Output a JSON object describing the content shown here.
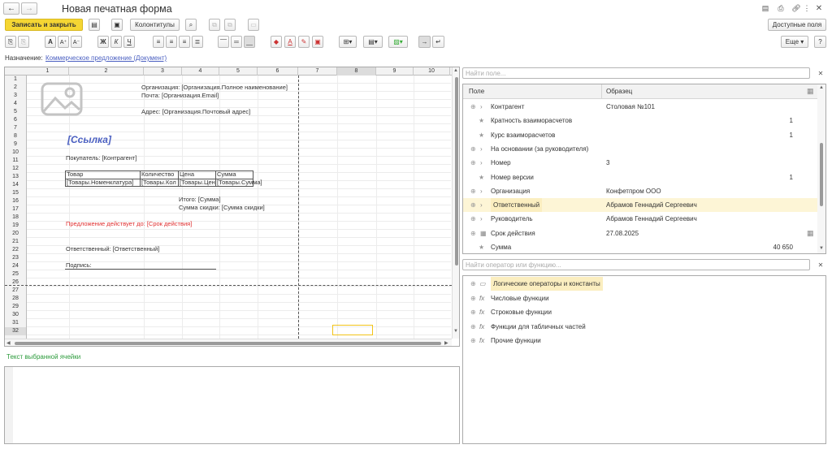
{
  "window": {
    "title": "Новая печатная форма"
  },
  "toolbar": {
    "save_close": "Записать и закрыть",
    "headers_footers": "Колонтитулы",
    "available_fields": "Доступные поля",
    "more": "Еще",
    "help": "?"
  },
  "purpose": {
    "label": "Назначение:",
    "value": "Коммерческое предложение (Документ)"
  },
  "sheet": {
    "col_headers": [
      "1",
      "2",
      "3",
      "4",
      "5",
      "6",
      "7",
      "8",
      "9",
      "10"
    ],
    "row_numbers": [
      "1",
      "2",
      "3",
      "4",
      "5",
      "6",
      "7",
      "8",
      "9",
      "10",
      "11",
      "12",
      "13",
      "14",
      "15",
      "16",
      "17",
      "18",
      "19",
      "20",
      "21",
      "22",
      "23",
      "24",
      "25",
      "26",
      "27",
      "28",
      "29",
      "30",
      "31",
      "32"
    ],
    "org_name": "Организация: [Организация.Полное наименование]",
    "mail": "Почта: [Организация.Email]",
    "address": "Адрес: [Организация.Почтовый адрес]",
    "link": "[Ссылка]",
    "buyer": "Покупатель: [Контрагент]",
    "h_goods": "Товар",
    "h_qty": "Количество",
    "h_price": "Цена",
    "h_sum": "Сумма",
    "v_goods": "[Товары.Номенклатура]",
    "v_qty": "[Товары.Кол",
    "v_price": "[Товары.Цен",
    "v_sum": "[Товары.Сумма]",
    "total": "Итого: [Сумма]",
    "discount": "Сумма скидки: [Сумма скидки]",
    "validity": "Предложение действует до: [Срок действия]",
    "responsible": "Ответственный: [Ответственный]",
    "signature": "Подпись:"
  },
  "cell_text_label": "Текст выбранной ячейки",
  "fields": {
    "search_placeholder": "Найти поле...",
    "col_field": "Поле",
    "col_sample": "Образец",
    "rows": [
      {
        "name": "Контрагент",
        "sample": "Столовая №101",
        "num": ""
      },
      {
        "name": "Кратность взаиморасчетов",
        "sample": "",
        "num": "1"
      },
      {
        "name": "Курс взаиморасчетов",
        "sample": "",
        "num": "1"
      },
      {
        "name": "На основании (за руководителя)",
        "sample": "",
        "num": ""
      },
      {
        "name": "Номер",
        "sample": "3",
        "num": ""
      },
      {
        "name": "Номер версии",
        "sample": "",
        "num": "1"
      },
      {
        "name": "Организация",
        "sample": "Конфетпром ООО",
        "num": ""
      },
      {
        "name": "Ответственный",
        "sample": "Абрамов Геннадий Сергеевич",
        "num": ""
      },
      {
        "name": "Руководитель",
        "sample": "Абрамов Геннадий Сергеевич",
        "num": ""
      },
      {
        "name": "Срок действия",
        "sample": "27.08.2025",
        "num": ""
      },
      {
        "name": "Сумма",
        "sample": "",
        "num": "40 650"
      }
    ]
  },
  "functions": {
    "search_placeholder": "Найти оператор или функцию...",
    "rows": [
      "Логические операторы и константы",
      "Числовые функции",
      "Строковые функции",
      "Функции для табличных частей",
      "Прочие функции"
    ]
  },
  "colors": {
    "accent": "#f5d633",
    "link": "#4a5fc1",
    "red": "#e03030",
    "green": "#2a9a3a",
    "highlight": "#fbeec0"
  }
}
